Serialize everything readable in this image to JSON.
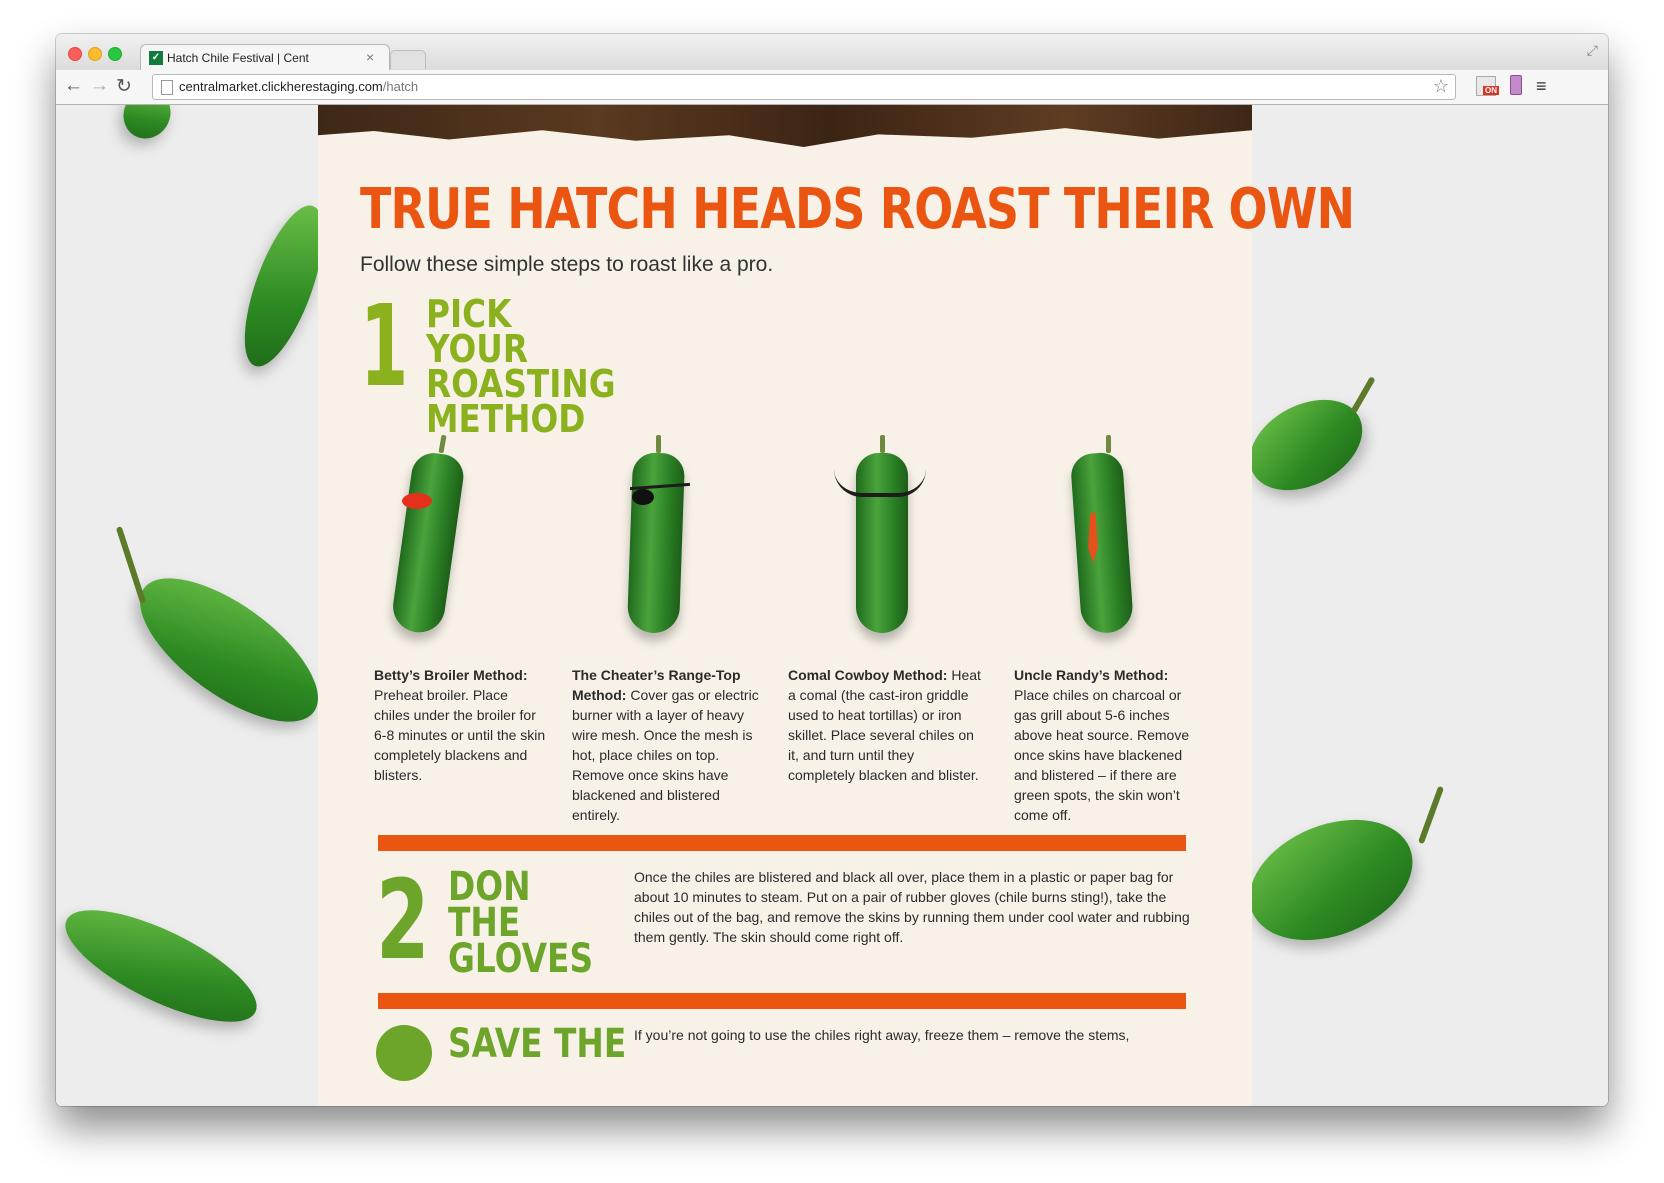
{
  "browser": {
    "tab_title": "Hatch Chile Festival | Cent",
    "tab_favicon": "central-market-logo",
    "url_domain": "centralmarket.clickherestaging.com",
    "url_path": "/hatch",
    "extension_badge": "ON"
  },
  "page": {
    "headline": "TRUE HATCH HEADS ROAST THEIR OWN",
    "subheading": "Follow these simple steps to roast like a pro.",
    "colors": {
      "accent_orange": "#ea5512",
      "accent_green": "#8bb11f",
      "paper": "#f7f1e8"
    },
    "step1": {
      "number": "1",
      "title": "PICK YOUR ROASTING METHOD",
      "methods": [
        {
          "name": "Betty’s Broiler Method:",
          "text": "Preheat broiler. Place chiles under the broiler for 6-8 minutes or until the skin completely blackens and blisters."
        },
        {
          "name": "The Cheater’s Range-Top Method:",
          "text": "Cover gas or electric burner with a layer of heavy wire mesh. Once the mesh is hot, place chiles on top. Remove once skins have blackened and blistered entirely."
        },
        {
          "name": "Comal Cowboy Method:",
          "text": "Heat a comal (the cast-iron griddle used to heat tortillas) or iron skillet. Place several chiles on it, and turn until they completely blacken and blister."
        },
        {
          "name": "Uncle Randy’s Method:",
          "text": "Place chiles on charcoal or gas grill about 5-6 inches above heat source. Remove once skins have blackened and blistered – if there are green spots, the skin won’t come off."
        }
      ]
    },
    "step2": {
      "number": "2",
      "title": "DON THE GLOVES",
      "body": "Once the chiles are blistered and black all over, place them in a plastic or paper bag for about 10 minutes to steam. Put on a pair of rubber gloves (chile burns sting!), take the chiles out of the bag, and remove the skins by running them under cool water and rubbing them gently. The skin should come right off."
    },
    "step3": {
      "title": "SAVE THE",
      "body": "If you’re not going to use the chiles right away, freeze them – remove the stems,"
    }
  }
}
